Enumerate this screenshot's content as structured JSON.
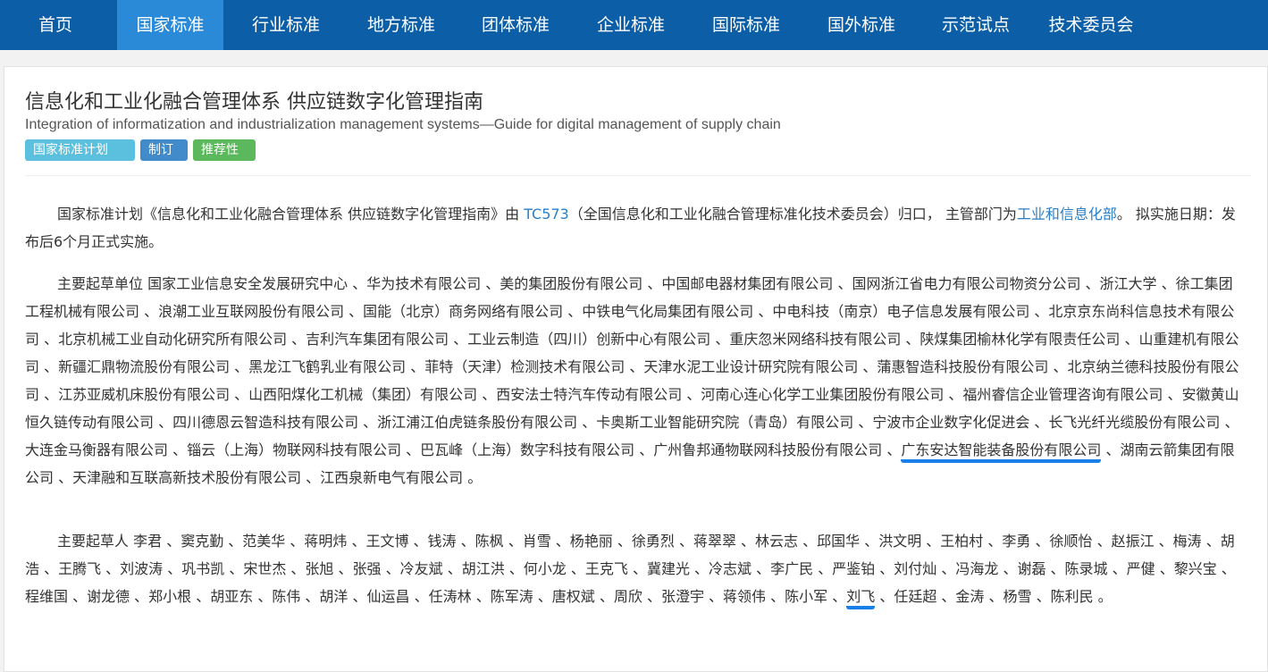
{
  "nav": {
    "items": [
      {
        "label": "首页"
      },
      {
        "label": "国家标准"
      },
      {
        "label": "行业标准"
      },
      {
        "label": "地方标准"
      },
      {
        "label": "团体标准"
      },
      {
        "label": "企业标准"
      },
      {
        "label": "国际标准"
      },
      {
        "label": "国外标准"
      },
      {
        "label": "示范试点"
      },
      {
        "label": "技术委员会"
      }
    ],
    "active_index": 1
  },
  "colors": {
    "nav_bg": "#0c5ea6",
    "nav_active": "#2a8ad8",
    "link": "#2a7fc7",
    "badge_plan": "#5bc0de",
    "badge_revise": "#428bca",
    "badge_recommend": "#5cb85c",
    "underline": "#1a7fe8"
  },
  "standard": {
    "title_cn": "信息化和工业化融合管理体系 供应链数字化管理指南",
    "title_en": "Integration of informatization and industrialization management systems—Guide for digital management of supply chain",
    "badges": [
      "国家标准计划",
      "制订",
      "推荐性"
    ]
  },
  "intro": {
    "t1": "国家标准计划《信息化和工业化融合管理体系 供应链数字化管理指南》由 ",
    "tc_link": "TC573",
    "t2": "（全国信息化和工业化融合管理标准化技术委员会）归口， 主管部门为",
    "dept_link": "工业和信息化部",
    "t3": "。 拟实施日期：发布后6个月正式实施。"
  },
  "drafting_units": {
    "label": "主要起草单位",
    "before": " 国家工业信息安全发展研究中心 、华为技术有限公司 、美的集团股份有限公司 、中国邮电器材集团有限公司 、国网浙江省电力有限公司物资分公司 、浙江大学 、徐工集团工程机械有限公司 、浪潮工业互联网股份有限公司 、国能（北京）商务网络有限公司 、中铁电气化局集团有限公司 、中电科技（南京）电子信息发展有限公司 、北京京东尚科信息技术有限公司 、北京机械工业自动化研究所有限公司 、吉利汽车集团有限公司 、工业云制造（四川）创新中心有限公司 、重庆忽米网络科技有限公司 、陕煤集团榆林化学有限责任公司 、山重建机有限公司 、新疆汇鼎物流股份有限公司 、黑龙江飞鹤乳业有限公司 、菲特（天津）检测技术有限公司 、天津水泥工业设计研究院有限公司 、蒲惠智造科技股份有限公司 、北京纳兰德科技股份有限公司 、江苏亚威机床股份有限公司 、山西阳煤化工机械（集团）有限公司 、西安法士特汽车传动有限公司 、河南心连心化学工业集团股份有限公司 、福州睿信企业管理咨询有限公司 、安徽黄山恒久链传动有限公司 、四川德恩云智造科技有限公司 、浙江浦江伯虎链条股份有限公司 、卡奥斯工业智能研究院（青岛）有限公司 、宁波市企业数字化促进会 、长飞光纤光缆股份有限公司 、大连金马衡器有限公司 、锱云（上海）物联网科技有限公司 、巴瓦峰（上海）数字科技有限公司 、广州鲁邦通物联网科技股份有限公司 、",
    "highlight": "广东安达智能装备股份有限公司",
    "after": " 、湖南云箭集团有限公司 、天津融和互联高新技术股份有限公司 、江西泉新电气有限公司 。"
  },
  "drafters": {
    "label": "主要起草人",
    "before": " 李君 、窦克勤 、范美华 、蒋明炜 、王文博 、钱涛 、陈枫 、肖雪 、杨艳丽 、徐勇烈 、蒋翠翠 、林云志 、邱国华 、洪文明 、王柏村 、李勇 、徐顺怡 、赵振江 、梅涛 、胡浩 、王腾飞 、刘波涛 、巩书凯 、宋世杰 、张旭 、张强 、冷友斌 、胡江洪 、何小龙 、王克飞 、冀建光 、冷志斌 、李广民 、严鉴铂 、刘付灿 、冯海龙 、谢磊 、陈录城 、严健 、黎兴宝 、程维国 、谢龙德 、郑小根 、胡亚东 、陈伟 、胡洋 、仙运昌 、任涛林 、陈军涛 、唐权斌 、周欣 、张澄宇 、蒋领伟 、陈小军 、",
    "highlight": "刘飞",
    "after": " 、任廷超 、金涛 、杨雪 、陈利民 。"
  }
}
